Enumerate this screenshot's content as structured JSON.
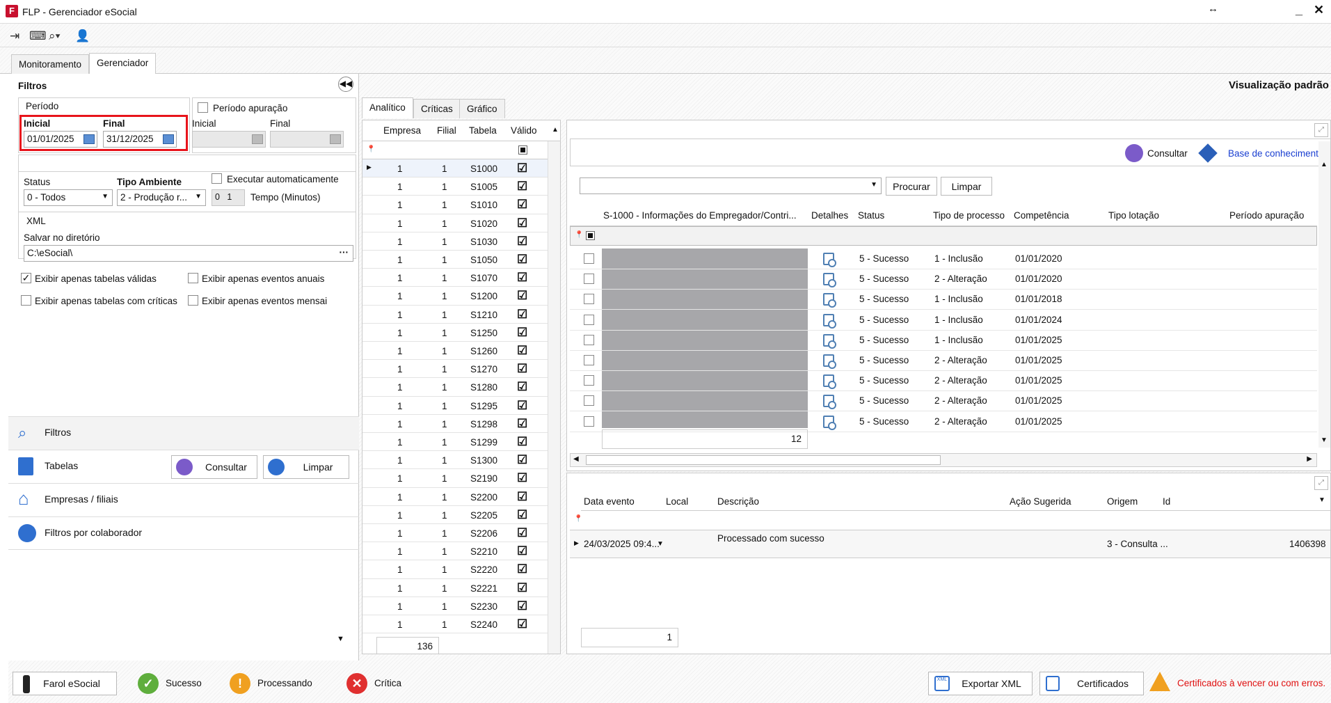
{
  "window": {
    "title": "FLP - Gerenciador eSocial"
  },
  "tabs": [
    "Monitoramento",
    "Gerenciador"
  ],
  "filters": {
    "title": "Filtros",
    "periodo_label": "Período",
    "inicial_label": "Inicial",
    "final_label": "Final",
    "inicial_value": "01/01/2025",
    "final_value": "31/12/2025",
    "apuracao_label": "Período apuração",
    "apuracao_inicial_label": "Inicial",
    "apuracao_final_label": "Final",
    "status_label": "Status",
    "status_value": "0 - Todos",
    "ambiente_label": "Tipo Ambiente",
    "ambiente_value": "2 - Produção r...",
    "exec_label": "Executar automaticamente",
    "tempo_value": "0",
    "tempo_spin": "1",
    "tempo_label": "Tempo (Minutos)",
    "xml_label": "XML",
    "salvar_label": "Salvar no diretório",
    "salvar_value": "C:\\eSocial\\",
    "opt1": "Exibir apenas tabelas válidas",
    "opt2": "Exibir apenas eventos anuais",
    "opt3": "Exibir apenas tabelas com críticas",
    "opt4": "Exibir apenas eventos mensai",
    "consultar": "Consultar",
    "limpar": "Limpar"
  },
  "nav": [
    "Filtros",
    "Tabelas",
    "Empresas / filiais",
    "Filtros por colaborador"
  ],
  "view_label": "Visualização padrão",
  "center_tabs": [
    "Analítico",
    "Críticas",
    "Gráfico"
  ],
  "table1": {
    "headers": [
      "Empresa",
      "Filial",
      "Tabela",
      "Válido"
    ],
    "rows": [
      [
        "1",
        "1",
        "S1000"
      ],
      [
        "1",
        "1",
        "S1005"
      ],
      [
        "1",
        "1",
        "S1010"
      ],
      [
        "1",
        "1",
        "S1020"
      ],
      [
        "1",
        "1",
        "S1030"
      ],
      [
        "1",
        "1",
        "S1050"
      ],
      [
        "1",
        "1",
        "S1070"
      ],
      [
        "1",
        "1",
        "S1200"
      ],
      [
        "1",
        "1",
        "S1210"
      ],
      [
        "1",
        "1",
        "S1250"
      ],
      [
        "1",
        "1",
        "S1260"
      ],
      [
        "1",
        "1",
        "S1270"
      ],
      [
        "1",
        "1",
        "S1280"
      ],
      [
        "1",
        "1",
        "S1295"
      ],
      [
        "1",
        "1",
        "S1298"
      ],
      [
        "1",
        "1",
        "S1299"
      ],
      [
        "1",
        "1",
        "S1300"
      ],
      [
        "1",
        "1",
        "S2190"
      ],
      [
        "1",
        "1",
        "S2200"
      ],
      [
        "1",
        "1",
        "S2205"
      ],
      [
        "1",
        "1",
        "S2206"
      ],
      [
        "1",
        "1",
        "S2210"
      ],
      [
        "1",
        "1",
        "S2220"
      ],
      [
        "1",
        "1",
        "S2221"
      ],
      [
        "1",
        "1",
        "S2230"
      ],
      [
        "1",
        "1",
        "S2240"
      ]
    ],
    "count": "136"
  },
  "right": {
    "consultar": "Consultar",
    "base": "Base de conhecimento",
    "procurar": "Procurar",
    "limpar": "Limpar",
    "headers": [
      "S-1000 - Informações do Empregador/Contri...",
      "Detalhes",
      "Status",
      "Tipo de processo",
      "Competência",
      "Tipo lotação",
      "Período apuração"
    ],
    "rows": [
      [
        "5 - Sucesso",
        "1 - Inclusão",
        "01/01/2020"
      ],
      [
        "5 - Sucesso",
        "2 - Alteração",
        "01/01/2020"
      ],
      [
        "5 - Sucesso",
        "1 - Inclusão",
        "01/01/2018"
      ],
      [
        "5 - Sucesso",
        "1 - Inclusão",
        "01/01/2024"
      ],
      [
        "5 - Sucesso",
        "1 - Inclusão",
        "01/01/2025"
      ],
      [
        "5 - Sucesso",
        "2 - Alteração",
        "01/01/2025"
      ],
      [
        "5 - Sucesso",
        "2 - Alteração",
        "01/01/2025"
      ],
      [
        "5 - Sucesso",
        "2 - Alteração",
        "01/01/2025"
      ],
      [
        "5 - Sucesso",
        "2 - Alteração",
        "01/01/2025"
      ]
    ],
    "count": "12"
  },
  "events": {
    "headers": [
      "Data evento",
      "Local",
      "Descrição",
      "Ação Sugerida",
      "Origem",
      "Id"
    ],
    "row": {
      "data": "24/03/2025 09:4...",
      "descricao": "Processado com sucesso",
      "origem": "3 - Consulta ...",
      "id": "1406398"
    },
    "count": "1"
  },
  "statusbar": {
    "farol": "Farol eSocial",
    "sucesso": "Sucesso",
    "processando": "Processando",
    "critica": "Crítica",
    "exportar": "Exportar XML",
    "certificados": "Certificados",
    "cert_warning": "Certificados à vencer ou com erros."
  },
  "colors": {
    "highlight": "#e8141b",
    "link": "#1a3fd1",
    "warning": "#e01010"
  }
}
